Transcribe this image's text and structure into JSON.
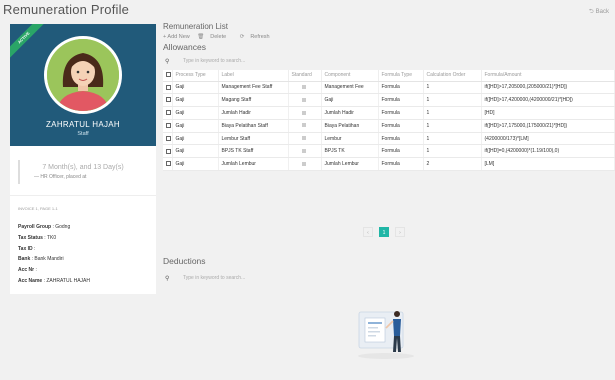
{
  "header": {
    "title": "Remuneration Profile",
    "back_label": "Back"
  },
  "profile": {
    "ribbon": "ACTIVE",
    "name": "ZAHRATUL HAJAH",
    "role": "Staff",
    "tenure": "7 Month(s), and 13 Day(s)",
    "tenure_sub": "— HR Officer, placed at",
    "info_hint": "INVOICE 1, PAGE 1-1",
    "fields": [
      {
        "label": "Payroll Group",
        "value": "Godng"
      },
      {
        "label": "Tax Status",
        "value": "TK0"
      },
      {
        "label": "Tax ID",
        "value": ""
      },
      {
        "label": "Bank",
        "value": "Bank Mandiri"
      },
      {
        "label": "Acc Nr",
        "value": ""
      },
      {
        "label": "Acc Name",
        "value": "ZAHRATUL HAJAH"
      }
    ]
  },
  "list": {
    "title": "Remuneration List",
    "toolbar": {
      "add": "+ Add New",
      "delete": "Delete",
      "refresh": "Refresh"
    }
  },
  "allowances": {
    "title": "Allowances",
    "search_placeholder": "Type in keyword to search...",
    "columns": [
      "Process Type",
      "Label",
      "Standard",
      "Component",
      "Formula Type",
      "Calculation Order",
      "Formula/Amount"
    ],
    "rows": [
      [
        "Gaji",
        "Management Fee Staff",
        "",
        "Management Fee",
        "Formula",
        "1",
        "if([HD]>17,205000,(205000/21)*[HD])"
      ],
      [
        "Gaji",
        "Magang Staff",
        "",
        "Gaji",
        "Formula",
        "1",
        "if([HD]>17,4200000,(4200000/21)*[HD])"
      ],
      [
        "Gaji",
        "Jumlah Hadir",
        "",
        "Jumlah Hadir",
        "Formula",
        "1",
        "[HD]"
      ],
      [
        "Gaji",
        "Biaya Pelatihan Staff",
        "",
        "Biaya Pelatihan",
        "Formula",
        "1",
        "if([HD]>17,175000,(175000/21)*[HD])"
      ],
      [
        "Gaji",
        "Lembur Staff",
        "",
        "Lembur",
        "Formula",
        "1",
        "(4200000/173)*[LM]"
      ],
      [
        "Gaji",
        "BPJS TK Staff",
        "",
        "BPJS TK",
        "Formula",
        "1",
        "if([HD]=0,(4200000)*(1.19/100),0)"
      ],
      [
        "Gaji",
        "Jumlah Lembur",
        "",
        "Jumlah Lembur",
        "Formula",
        "2",
        "[LM]"
      ]
    ],
    "pagination": {
      "prev": "‹",
      "current": "1",
      "next": "›"
    }
  },
  "deductions": {
    "title": "Deductions",
    "search_placeholder": "Type in keyword to search..."
  },
  "colors": {
    "brand": "#215a7a",
    "accent": "#20b6a6",
    "ribbon": "#2aa567"
  }
}
